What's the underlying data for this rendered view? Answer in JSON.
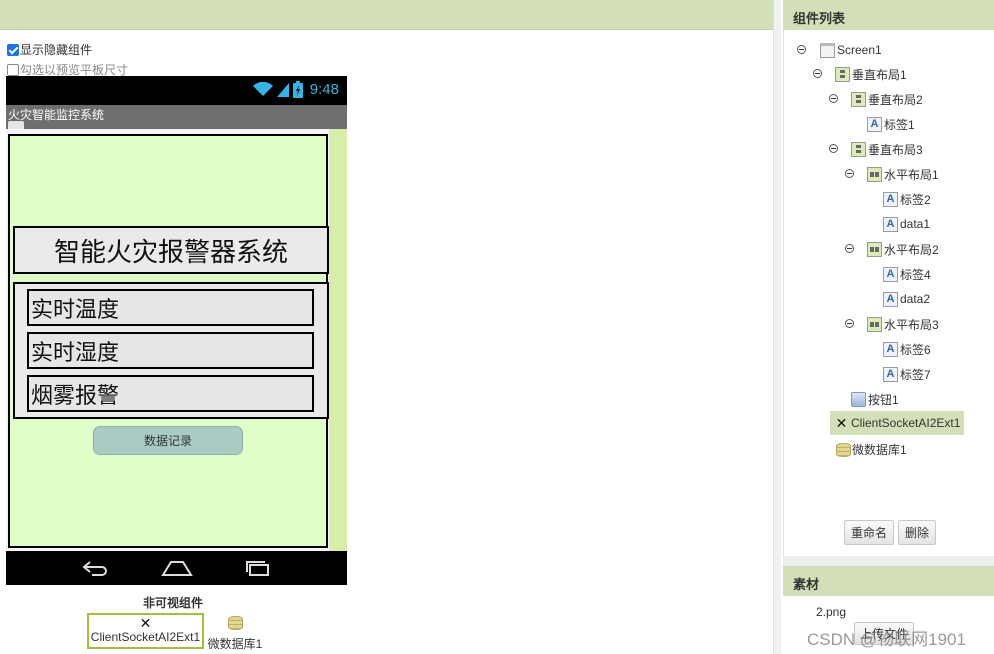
{
  "viewer": {
    "show_hidden_label": "显示隐藏组件",
    "show_hidden_checked": true,
    "tablet_preview_label": "勾选以预览平板尺寸",
    "tablet_preview_checked": false
  },
  "phone": {
    "time": "9:48",
    "app_title": "火灾智能监控系统",
    "heading": "智能火灾报警器系统",
    "rows": [
      "实时温度",
      "实时湿度",
      "烟雾报警"
    ],
    "record_button": "数据记录"
  },
  "nonvisible": {
    "title": "非可视组件",
    "items": [
      {
        "label": "ClientSocketAI2Ext1",
        "icon": "socket-icon",
        "selected": true
      },
      {
        "label": "微数据库1",
        "icon": "database-icon",
        "selected": false
      }
    ]
  },
  "components": {
    "header": "组件列表",
    "tree": [
      {
        "label": "Screen1",
        "icon": "screen-icon",
        "toggle": true
      },
      {
        "label": "垂直布局1",
        "icon": "vertical-layout-icon",
        "toggle": true
      },
      {
        "label": "垂直布局2",
        "icon": "vertical-layout-icon",
        "toggle": true
      },
      {
        "label": "标签1",
        "icon": "label-icon",
        "toggle": false
      },
      {
        "label": "垂直布局3",
        "icon": "vertical-layout-icon",
        "toggle": true
      },
      {
        "label": "水平布局1",
        "icon": "horizontal-layout-icon",
        "toggle": true
      },
      {
        "label": "标签2",
        "icon": "label-icon",
        "toggle": false
      },
      {
        "label": "data1",
        "icon": "label-icon",
        "toggle": false
      },
      {
        "label": "水平布局2",
        "icon": "horizontal-layout-icon",
        "toggle": true
      },
      {
        "label": "标签4",
        "icon": "label-icon",
        "toggle": false
      },
      {
        "label": "data2",
        "icon": "label-icon",
        "toggle": false
      },
      {
        "label": "水平布局3",
        "icon": "horizontal-layout-icon",
        "toggle": true
      },
      {
        "label": "标签6",
        "icon": "label-icon",
        "toggle": false
      },
      {
        "label": "标签7",
        "icon": "label-icon",
        "toggle": false
      },
      {
        "label": "按钮1",
        "icon": "button-icon",
        "toggle": false
      },
      {
        "label": "ClientSocketAI2Ext1",
        "icon": "socket-icon",
        "toggle": false,
        "selected": true
      },
      {
        "label": "微数据库1",
        "icon": "database-icon",
        "toggle": false
      }
    ],
    "rename_button": "重命名",
    "delete_button": "删除"
  },
  "assets": {
    "header": "素材",
    "files": [
      "2.png"
    ],
    "upload_button": "上传文件"
  },
  "watermark": "CSDN @物联网1901",
  "colors": {
    "header_green": "#d3e0b7",
    "canvas_green": "#e0ffc8",
    "accent_cyan": "#33b5e5"
  }
}
